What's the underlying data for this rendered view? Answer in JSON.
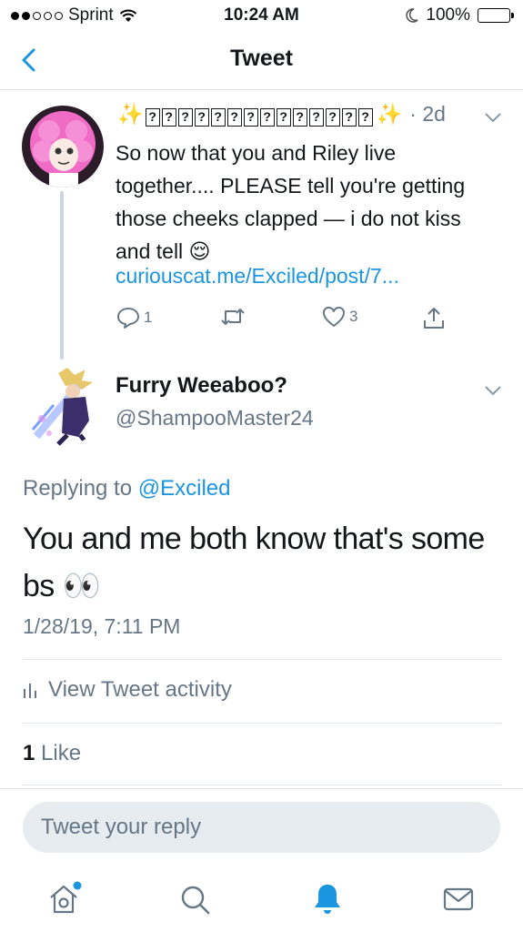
{
  "status_bar": {
    "carrier": "Sprint",
    "time": "10:24 AM",
    "battery": "100%"
  },
  "nav": {
    "title": "Tweet"
  },
  "parent_tweet": {
    "time_ago": "· 2d",
    "text": "So now that you and Riley live together.... PLEASE tell you're getting those cheeks clapped — i do not kiss and tell 😌",
    "link": "curiouscat.me/Exciled/post/7...",
    "reply_count": "1",
    "like_count": "3"
  },
  "reply_tweet": {
    "name": "Furry Weeaboo?",
    "handle": "@ShampooMaster24",
    "replying_prefix": "Replying to",
    "replying_handle": "@Exciled",
    "text": "You and me both know that's some bs 👀",
    "timestamp": "1/28/19, 7:11 PM",
    "activity_label": "View Tweet activity",
    "like_count": "1",
    "like_label": "Like"
  },
  "composer": {
    "placeholder": "Tweet your reply"
  },
  "colors": {
    "accent": "#1b95e0",
    "secondary_text": "#657786",
    "battery": "#f4c400"
  },
  "icons": {
    "back": "chevron-left-icon",
    "reply": "reply-icon",
    "retweet": "retweet-icon",
    "like": "heart-icon",
    "share": "share-icon",
    "home": "home-icon",
    "search": "search-icon",
    "notifications": "bell-icon",
    "messages": "mail-icon"
  }
}
